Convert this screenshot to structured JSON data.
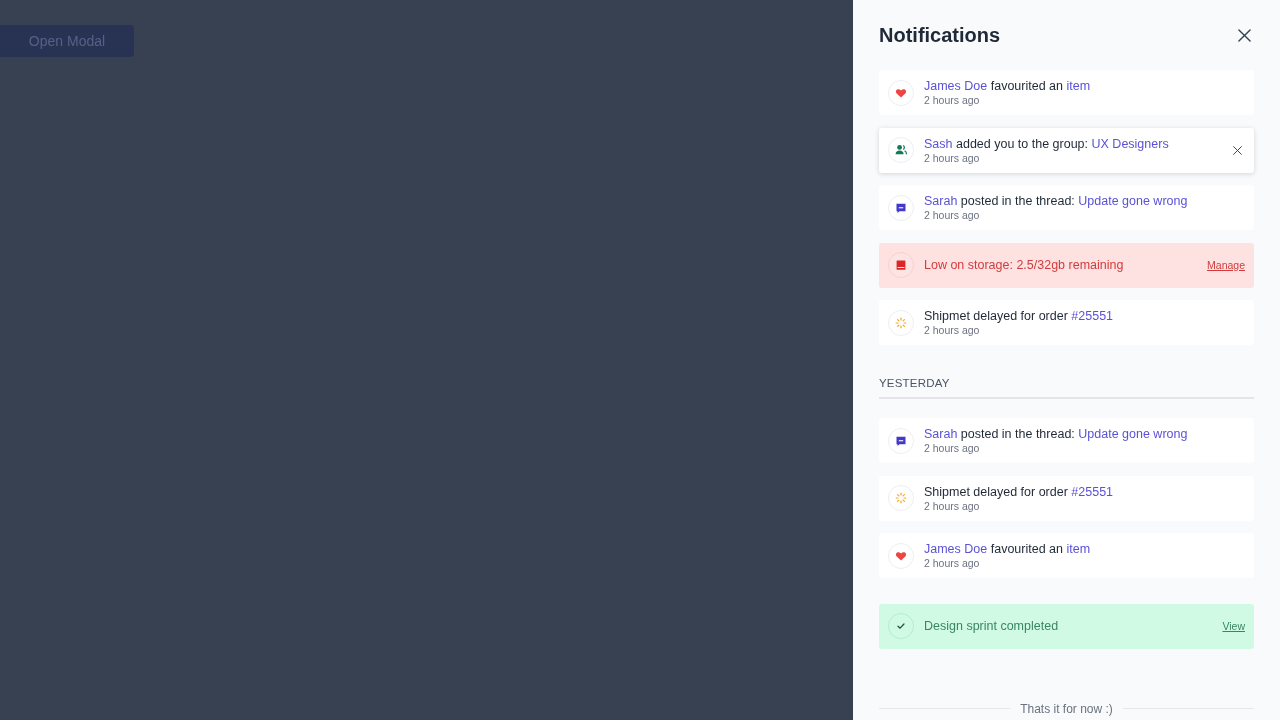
{
  "page": {
    "open_button": "Open Modal"
  },
  "drawer": {
    "title": "Notifications",
    "notifications": [
      {
        "kind": "like",
        "actor": "James Doe",
        "action": "favourited an",
        "target": "item",
        "time": "2 hours ago",
        "hovered": false
      },
      {
        "kind": "group",
        "actor": "Sash",
        "action": "added you to the group:",
        "target": "UX Designers",
        "time": "2 hours ago",
        "hovered": true
      },
      {
        "kind": "thread",
        "actor": "Sarah",
        "action": "posted in the thread:",
        "target": "Update gone wrong",
        "time": "2 hours ago",
        "hovered": false
      },
      {
        "kind": "storage",
        "message": "Low on storage: 2.5/32gb remaining",
        "link": "Manage",
        "hovered": false
      },
      {
        "kind": "shipment",
        "action": "Shipmet delayed for order",
        "target": "#25551",
        "time": "2 hours ago",
        "hovered": false
      }
    ],
    "sections": [
      {
        "heading": "YESTERDAY",
        "notifications": [
          {
            "kind": "thread",
            "actor": "Sarah",
            "action": "posted in the thread:",
            "target": "Update gone wrong",
            "time": "2 hours ago",
            "hovered": false
          },
          {
            "kind": "shipment",
            "action": "Shipmet delayed for order",
            "target": "#25551",
            "time": "2 hours ago",
            "hovered": false
          },
          {
            "kind": "like",
            "actor": "James Doe",
            "action": "favourited an",
            "target": "item",
            "time": "2 hours ago",
            "hovered": false
          }
        ]
      },
      {
        "notifications": [
          {
            "kind": "done",
            "message": "Design sprint completed",
            "link": "View",
            "hovered": false
          }
        ]
      }
    ],
    "footer": "Thats it for now :)"
  }
}
